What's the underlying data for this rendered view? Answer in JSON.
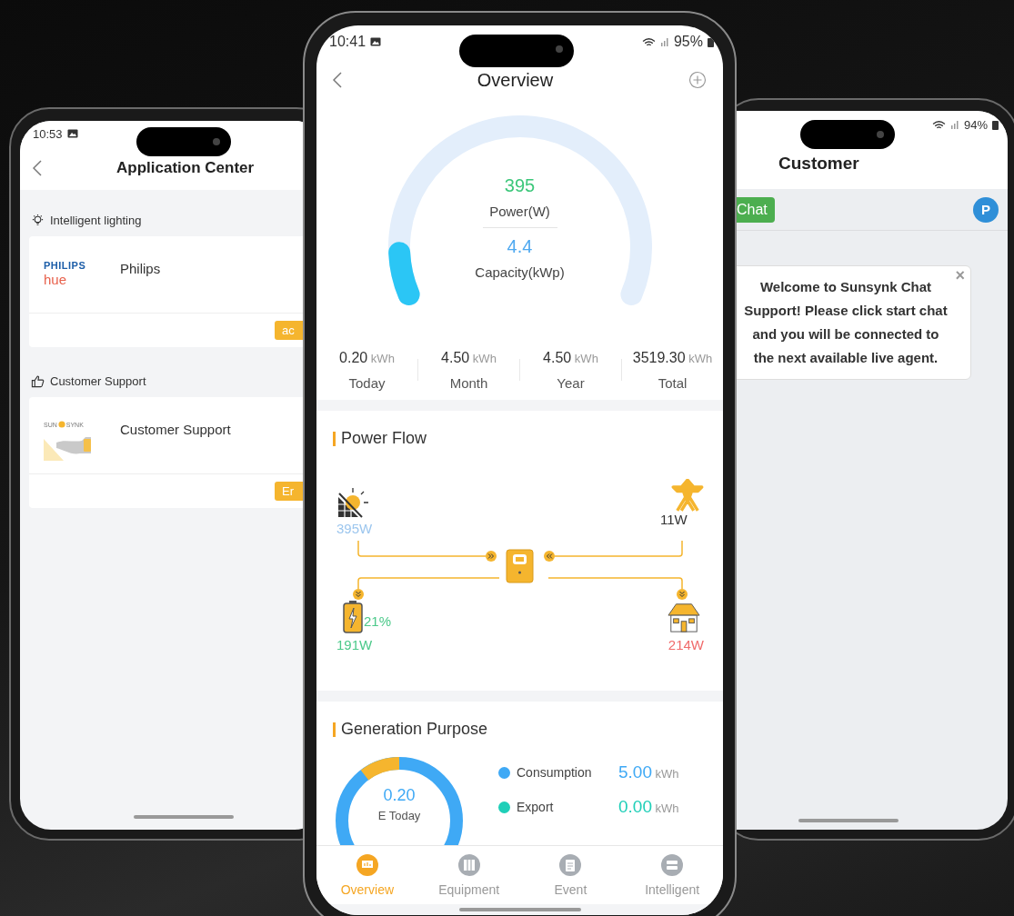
{
  "left_phone": {
    "status_bar": {
      "time": "10:53"
    },
    "title": "Application Center",
    "sections": [
      {
        "kind": "lighting",
        "heading": "Intelligent lighting",
        "apps": [
          {
            "kind": "philips",
            "brand": "PHILIPS",
            "brand_sub": "hue",
            "name": "Philips",
            "button": "ac"
          }
        ]
      },
      {
        "kind": "support",
        "heading": "Customer Support",
        "apps": [
          {
            "kind": "sunsynk",
            "brand": "SUN",
            "brand_sub": "SYNK",
            "name": "Customer Support",
            "button": "Er"
          }
        ]
      }
    ]
  },
  "center_phone": {
    "status_bar": {
      "time": "10:41",
      "battery": "95%"
    },
    "title": "Overview",
    "gauge": {
      "value": "395",
      "value_label": "Power(W)",
      "capacity": "4.4",
      "capacity_label": "Capacity(kWp)",
      "level": 0.09
    },
    "stats": [
      {
        "value": "0.20",
        "unit": "kWh",
        "label": "Today"
      },
      {
        "value": "4.50",
        "unit": "kWh",
        "label": "Month"
      },
      {
        "value": "4.50",
        "unit": "kWh",
        "label": "Year"
      },
      {
        "value": "3519.30",
        "unit": "kWh",
        "label": "Total"
      }
    ],
    "power_flow": {
      "title": "Power Flow",
      "nodes": [
        {
          "kind": "solar",
          "reading": "395W",
          "color": "#9cc6ee"
        },
        {
          "kind": "grid",
          "reading": "11W",
          "color": "#333333"
        },
        {
          "kind": "battery",
          "reading": "191W",
          "soc": "21%",
          "color": "#4cc98a"
        },
        {
          "kind": "home",
          "reading": "214W",
          "color": "#f06b6b"
        }
      ]
    },
    "generation": {
      "title": "Generation Purpose",
      "center_value": "0.20",
      "center_label": "E Today",
      "legend": [
        {
          "label": "Consumption",
          "value": "5.00",
          "unit": "kWh",
          "color": "#3fa9f5"
        },
        {
          "label": "Export",
          "value": "0.00",
          "unit": "kWh",
          "color": "#1fcfb8"
        }
      ]
    },
    "tabs": [
      {
        "kind": "overview",
        "label": "Overview",
        "selected": true
      },
      {
        "kind": "equipment",
        "label": "Equipment",
        "selected": false
      },
      {
        "kind": "event",
        "label": "Event",
        "selected": false
      },
      {
        "kind": "intelligent",
        "label": "Intelligent",
        "selected": false
      }
    ]
  },
  "right_phone": {
    "status_bar": {
      "battery": "94%"
    },
    "title": "Customer",
    "chat_button": "Chat",
    "avatar": "P",
    "message": {
      "text": "Welcome to Sunsynk Chat Support! Please click start chat and you will be connected to the next available live agent.",
      "close": "×"
    }
  }
}
